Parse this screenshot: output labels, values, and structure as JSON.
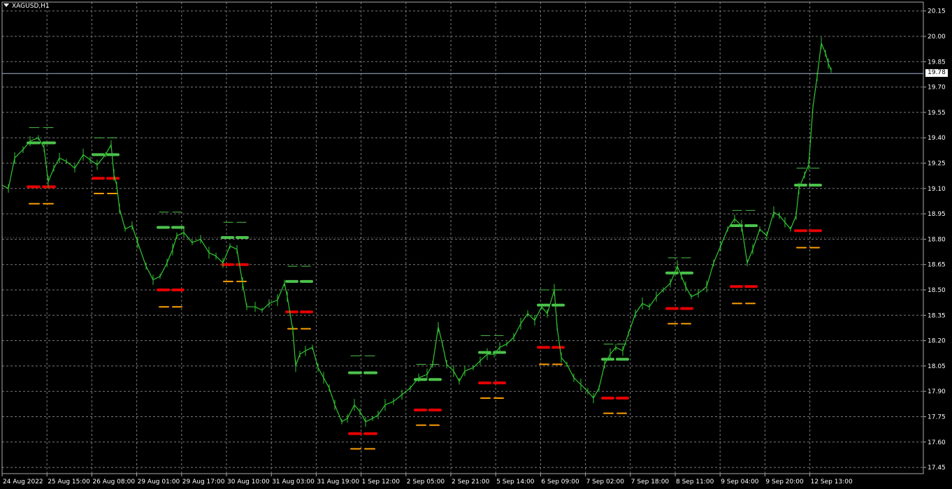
{
  "window": {
    "symbol_title": "XAGUSD,H1"
  },
  "colors": {
    "background": "#000000",
    "grid": "#7a7a7a",
    "price_line": "#32c832",
    "support_level": "#e60000",
    "support_offset": "#ff9f00",
    "resistance_level": "#4cc24c",
    "bid_line": "#a0b4d2"
  },
  "chart_data": {
    "type": "line",
    "symbol": "XAGUSD",
    "timeframe": "H1",
    "current_price": "19.78",
    "ylim": [
      17.38,
      20.2
    ],
    "y_ticks": [
      "20.15",
      "20.00",
      "19.85",
      "19.70",
      "19.55",
      "19.40",
      "19.25",
      "19.10",
      "18.95",
      "18.80",
      "18.65",
      "18.50",
      "18.35",
      "18.20",
      "18.05",
      "17.90",
      "17.75",
      "17.60",
      "17.45"
    ],
    "x_ticks": [
      "24 Aug 2022",
      "25 Aug 15:00",
      "26 Aug 08:00",
      "29 Aug 01:00",
      "29 Aug 17:00",
      "30 Aug 10:00",
      "31 Aug 03:00",
      "31 Aug 19:00",
      "1 Sep 12:00",
      "2 Sep 05:00",
      "2 Sep 21:00",
      "5 Sep 14:00",
      "6 Sep 09:00",
      "7 Sep 02:00",
      "7 Sep 18:00",
      "8 Sep 11:00",
      "9 Sep 04:00",
      "9 Sep 20:00",
      "12 Sep 13:00"
    ],
    "grid": true,
    "price_points": [
      [
        0,
        19.12
      ],
      [
        9,
        19.1
      ],
      [
        18,
        19.28
      ],
      [
        30,
        19.33
      ],
      [
        40,
        19.38
      ],
      [
        52,
        19.4
      ],
      [
        60,
        19.34
      ],
      [
        66,
        19.14
      ],
      [
        74,
        19.22
      ],
      [
        82,
        19.28
      ],
      [
        92,
        19.26
      ],
      [
        104,
        19.22
      ],
      [
        116,
        19.3
      ],
      [
        126,
        19.27
      ],
      [
        136,
        19.24
      ],
      [
        148,
        19.3
      ],
      [
        156,
        19.36
      ],
      [
        160,
        19.18
      ],
      [
        164,
        19.12
      ],
      [
        168,
        18.98
      ],
      [
        176,
        18.86
      ],
      [
        186,
        18.88
      ],
      [
        194,
        18.78
      ],
      [
        206,
        18.64
      ],
      [
        216,
        18.56
      ],
      [
        226,
        18.58
      ],
      [
        236,
        18.66
      ],
      [
        244,
        18.74
      ],
      [
        250,
        18.82
      ],
      [
        260,
        18.84
      ],
      [
        272,
        18.78
      ],
      [
        284,
        18.8
      ],
      [
        296,
        18.72
      ],
      [
        306,
        18.7
      ],
      [
        316,
        18.66
      ],
      [
        326,
        18.76
      ],
      [
        336,
        18.74
      ],
      [
        344,
        18.54
      ],
      [
        350,
        18.4
      ],
      [
        362,
        18.4
      ],
      [
        372,
        18.38
      ],
      [
        382,
        18.42
      ],
      [
        394,
        18.44
      ],
      [
        404,
        18.54
      ],
      [
        408,
        18.46
      ],
      [
        412,
        18.36
      ],
      [
        416,
        18.26
      ],
      [
        420,
        18.05
      ],
      [
        426,
        18.12
      ],
      [
        434,
        18.14
      ],
      [
        444,
        18.16
      ],
      [
        452,
        18.04
      ],
      [
        460,
        17.98
      ],
      [
        468,
        17.92
      ],
      [
        476,
        17.82
      ],
      [
        486,
        17.72
      ],
      [
        494,
        17.74
      ],
      [
        504,
        17.82
      ],
      [
        512,
        17.78
      ],
      [
        520,
        17.72
      ],
      [
        530,
        17.74
      ],
      [
        538,
        17.76
      ],
      [
        548,
        17.82
      ],
      [
        560,
        17.84
      ],
      [
        572,
        17.88
      ],
      [
        584,
        17.92
      ],
      [
        596,
        17.98
      ],
      [
        608,
        18.0
      ],
      [
        616,
        18.06
      ],
      [
        624,
        18.28
      ],
      [
        630,
        18.18
      ],
      [
        636,
        18.06
      ],
      [
        646,
        18.02
      ],
      [
        654,
        17.96
      ],
      [
        662,
        18.02
      ],
      [
        674,
        18.04
      ],
      [
        684,
        18.08
      ],
      [
        694,
        18.12
      ],
      [
        704,
        18.12
      ],
      [
        712,
        18.16
      ],
      [
        722,
        18.18
      ],
      [
        732,
        18.22
      ],
      [
        742,
        18.3
      ],
      [
        752,
        18.36
      ],
      [
        762,
        18.32
      ],
      [
        772,
        18.4
      ],
      [
        780,
        18.36
      ],
      [
        790,
        18.5
      ],
      [
        794,
        18.28
      ],
      [
        800,
        18.1
      ],
      [
        808,
        18.06
      ],
      [
        818,
        17.98
      ],
      [
        828,
        17.94
      ],
      [
        838,
        17.9
      ],
      [
        846,
        17.86
      ],
      [
        854,
        17.92
      ],
      [
        862,
        18.06
      ],
      [
        870,
        18.12
      ],
      [
        878,
        18.16
      ],
      [
        888,
        18.14
      ],
      [
        896,
        18.24
      ],
      [
        906,
        18.36
      ],
      [
        916,
        18.42
      ],
      [
        926,
        18.4
      ],
      [
        936,
        18.46
      ],
      [
        946,
        18.5
      ],
      [
        956,
        18.54
      ],
      [
        966,
        18.64
      ],
      [
        972,
        18.58
      ],
      [
        978,
        18.52
      ],
      [
        986,
        18.46
      ],
      [
        996,
        18.48
      ],
      [
        1008,
        18.52
      ],
      [
        1018,
        18.66
      ],
      [
        1028,
        18.76
      ],
      [
        1038,
        18.86
      ],
      [
        1048,
        18.92
      ],
      [
        1058,
        18.88
      ],
      [
        1066,
        18.66
      ],
      [
        1074,
        18.74
      ],
      [
        1084,
        18.86
      ],
      [
        1094,
        18.82
      ],
      [
        1104,
        18.96
      ],
      [
        1112,
        18.94
      ],
      [
        1120,
        18.9
      ],
      [
        1128,
        18.86
      ],
      [
        1136,
        18.94
      ],
      [
        1140,
        19.1
      ],
      [
        1148,
        19.18
      ],
      [
        1154,
        19.24
      ],
      [
        1160,
        19.58
      ],
      [
        1166,
        19.76
      ],
      [
        1172,
        19.96
      ],
      [
        1178,
        19.9
      ],
      [
        1182,
        19.84
      ],
      [
        1186,
        19.8
      ]
    ],
    "support_levels": [
      {
        "x_from": 40,
        "x_to": 78,
        "main": 19.11,
        "offset": 19.01
      },
      {
        "x_from": 133,
        "x_to": 169,
        "main": 19.16,
        "offset": 19.07
      },
      {
        "x_from": 226,
        "x_to": 262,
        "main": 18.5,
        "offset": 18.4
      },
      {
        "x_from": 318,
        "x_to": 354,
        "main": 18.65,
        "offset": 18.55
      },
      {
        "x_from": 410,
        "x_to": 446,
        "main": 18.37,
        "offset": 18.27
      },
      {
        "x_from": 500,
        "x_to": 538,
        "main": 17.65,
        "offset": 17.56
      },
      {
        "x_from": 594,
        "x_to": 630,
        "main": 17.79,
        "offset": 17.7
      },
      {
        "x_from": 686,
        "x_to": 722,
        "main": 17.95,
        "offset": 17.86
      },
      {
        "x_from": 770,
        "x_to": 806,
        "main": 18.16,
        "offset": 18.06
      },
      {
        "x_from": 862,
        "x_to": 898,
        "main": 17.86,
        "offset": 17.77
      },
      {
        "x_from": 954,
        "x_to": 990,
        "main": 18.39,
        "offset": 18.3
      },
      {
        "x_from": 1046,
        "x_to": 1082,
        "main": 18.52,
        "offset": 18.42
      },
      {
        "x_from": 1138,
        "x_to": 1174,
        "main": 18.85,
        "offset": 18.75
      }
    ],
    "resistance_levels": [
      {
        "x_from": 40,
        "x_to": 78,
        "main": 19.37,
        "upper": 19.46
      },
      {
        "x_from": 133,
        "x_to": 169,
        "main": 19.3,
        "upper": 19.4
      },
      {
        "x_from": 226,
        "x_to": 262,
        "main": 18.87,
        "upper": 18.96
      },
      {
        "x_from": 318,
        "x_to": 354,
        "main": 18.81,
        "upper": 18.9
      },
      {
        "x_from": 410,
        "x_to": 446,
        "main": 18.55,
        "upper": 18.64
      },
      {
        "x_from": 500,
        "x_to": 538,
        "main": 18.01,
        "upper": 18.11
      },
      {
        "x_from": 594,
        "x_to": 630,
        "main": 17.97,
        "upper": 18.06
      },
      {
        "x_from": 686,
        "x_to": 722,
        "main": 18.13,
        "upper": 18.23
      },
      {
        "x_from": 770,
        "x_to": 806,
        "main": 18.41,
        "upper": 18.5
      },
      {
        "x_from": 862,
        "x_to": 898,
        "main": 18.09,
        "upper": 18.18
      },
      {
        "x_from": 954,
        "x_to": 990,
        "main": 18.6,
        "upper": 18.69
      },
      {
        "x_from": 1046,
        "x_to": 1082,
        "main": 18.88,
        "upper": 18.97
      },
      {
        "x_from": 1138,
        "x_to": 1174,
        "main": 19.12,
        "upper": 19.22
      }
    ]
  }
}
